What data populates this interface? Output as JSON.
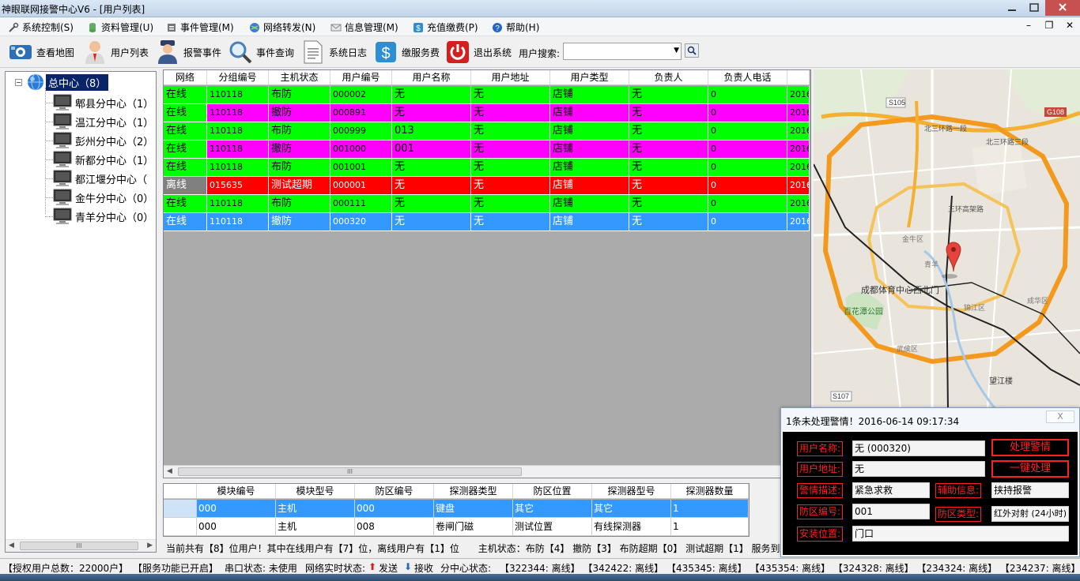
{
  "window": {
    "title": "神眼联网接警中心V6 - [用户列表]"
  },
  "menu": [
    {
      "label": "系统控制(S)",
      "icon": "tools-icon"
    },
    {
      "label": "资料管理(U)",
      "icon": "database-icon"
    },
    {
      "label": "事件管理(M)",
      "icon": "event-icon"
    },
    {
      "label": "网络转发(N)",
      "icon": "globe-icon"
    },
    {
      "label": "信息管理(M)",
      "icon": "mail-icon"
    },
    {
      "label": "充值缴费(P)",
      "icon": "payment-icon"
    },
    {
      "label": "帮助(H)",
      "icon": "help-icon"
    }
  ],
  "toolbar": {
    "buttons": [
      {
        "label": "查看地图",
        "icon": "map-view-icon"
      },
      {
        "label": "用户列表",
        "icon": "user-list-icon"
      },
      {
        "label": "报警事件",
        "icon": "police-icon"
      },
      {
        "label": "事件查询",
        "icon": "magnifier-icon"
      },
      {
        "label": "系统日志",
        "icon": "log-document-icon"
      },
      {
        "label": "缴服务费",
        "icon": "dollar-icon"
      },
      {
        "label": "退出系统",
        "icon": "power-icon"
      }
    ],
    "search_label": "用户搜索:",
    "search_value": ""
  },
  "tree": {
    "root": "总中心（8）",
    "children": [
      "郫县分中心（1）",
      "温江分中心（1）",
      "彭州分中心（2）",
      "新都分中心（1）",
      "都江堰分中心（",
      "金牛分中心（0）",
      "青羊分中心（0）"
    ]
  },
  "users": {
    "columns": [
      "网络",
      "分组编号",
      "主机状态",
      "用户编号",
      "用户名称",
      "用户地址",
      "用户类型",
      "负责人",
      "负责人电话",
      ""
    ],
    "rows": [
      {
        "cells": [
          "在线",
          "110118",
          "布防",
          "000002",
          "无",
          "无",
          "店铺",
          "无",
          "0",
          "2016"
        ],
        "color": "#00ff00"
      },
      {
        "cells": [
          "在线",
          "110118",
          "撤防",
          "000891",
          "无",
          "无",
          "店铺",
          "无",
          "0",
          "2016"
        ],
        "color": "#ff00ff",
        "first_color": "#00ff00"
      },
      {
        "cells": [
          "在线",
          "110118",
          "布防",
          "000999",
          "013",
          "无",
          "店铺",
          "无",
          "0",
          "2016"
        ],
        "color": "#00ff00"
      },
      {
        "cells": [
          "在线",
          "110118",
          "撤防",
          "001000",
          "001",
          "无",
          "店铺",
          "无",
          "0",
          "2016"
        ],
        "color": "#ff00ff",
        "first_color": "#00ff00"
      },
      {
        "cells": [
          "在线",
          "110118",
          "布防",
          "001001",
          "无",
          "无",
          "店铺",
          "无",
          "0",
          "2016"
        ],
        "color": "#00ff00"
      },
      {
        "cells": [
          "离线",
          "015635",
          "测试超期",
          "000001",
          "无",
          "无",
          "店铺",
          "无",
          "0",
          "2016"
        ],
        "color": "#ff0000",
        "first_color": "#808080"
      },
      {
        "cells": [
          "在线",
          "110118",
          "布防",
          "000111",
          "无",
          "无",
          "店铺",
          "无",
          "0",
          "2016"
        ],
        "color": "#00ff00"
      },
      {
        "cells": [
          "在线",
          "110118",
          "撤防",
          "000320",
          "无",
          "无",
          "店铺",
          "无",
          "0",
          "2016"
        ],
        "color": "#3399ff",
        "selected": true
      }
    ]
  },
  "modules": {
    "columns": [
      "",
      "模块编号",
      "模块型号",
      "防区编号",
      "探测器类型",
      "防区位置",
      "探测器型号",
      "探测器数量"
    ],
    "rows": [
      {
        "cells": [
          "",
          "000",
          "主机",
          "000",
          "键盘",
          "其它",
          "其它",
          "1"
        ],
        "selected": true
      },
      {
        "cells": [
          "",
          "000",
          "主机",
          "008",
          "卷闸门磁",
          "测试位置",
          "有线探测器",
          "1"
        ],
        "selected": false
      }
    ]
  },
  "stats": {
    "users_summary": "当前共有【8】位用户！其中在线用户有【7】位，离线用户有【1】位",
    "host_summary": "主机状态：布防【4】 撤防【3】 布防超期【0】 测试超期【1】 服务到期"
  },
  "map": {
    "labels": {
      "s105": "S105",
      "g108": "G108",
      "s107": "S107",
      "ring2_north": "北三环路一段",
      "ring2_north2": "北三环路三段",
      "ring3": "三环高架路",
      "stadium": "成都体育中心西北门",
      "park": "百花潭公园",
      "wangjiang": "望江楼",
      "jinniu": "金牛区",
      "chenghua": "成华区",
      "qingyang": "青羊",
      "wuhou": "武侯区",
      "jinjiang": "锦江区"
    }
  },
  "alert": {
    "title": "1条未处理警情！2016-06-14 09:17:34",
    "close": "X",
    "user_name_label": "用户名称:",
    "user_name": "无 (000320)",
    "user_addr_label": "用户地址:",
    "user_addr": "无",
    "alarm_desc_label": "警情描述:",
    "alarm_desc": "紧急求救",
    "aux_info_label": "辅助信息:",
    "aux_info": "挟持报警",
    "zone_no_label": "防区编号:",
    "zone_no": "001",
    "zone_type_label": "防区类型:",
    "zone_type": "红外对射 (24小时)",
    "install_pos_label": "安装位置:",
    "install_pos": "门口",
    "btn_handle": "处理警情",
    "btn_one_key": "一键处理"
  },
  "statusbar": {
    "licensed": "【授权用户总数：22000户】",
    "service": "【服务功能已开启】",
    "serial": "串口状态: 未使用",
    "network": "网络实时状态:",
    "send": "发送",
    "receive": "接收",
    "sub_center": "分中心状态:",
    "nodes": "【322344: 离线】 【342422: 离线】 【435345: 离线】 【435354: 离线】 【324328: 离线】 【234324: 离线】 【234237: 离线】"
  }
}
